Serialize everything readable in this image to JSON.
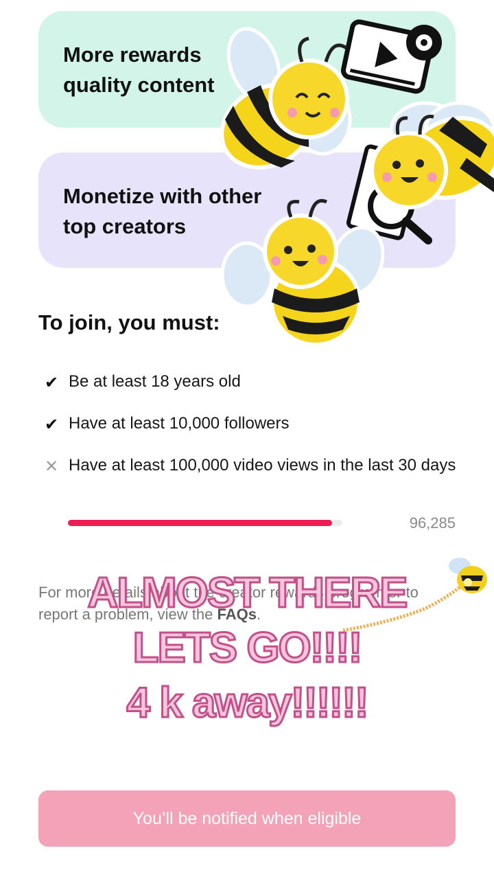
{
  "cards": [
    {
      "text": "More rewards\nquality content"
    },
    {
      "text": "Monetize with other\ntop creators"
    }
  ],
  "requirements": {
    "title": "To join, you must:",
    "items": [
      {
        "text": "Be at least 18 years old",
        "met": true,
        "icon": "check-icon"
      },
      {
        "text": "Have at least 10,000 followers",
        "met": true,
        "icon": "check-icon"
      },
      {
        "text": "Have at least 100,000 video views in the last 30 days",
        "met": false,
        "icon": "x-icon"
      }
    ],
    "progress": {
      "value_label": "96,285",
      "fraction": 0.963
    }
  },
  "faq": {
    "prefix": "For more details about the creator rewards program or to report a problem, view the ",
    "link": "FAQs",
    "suffix": "."
  },
  "overlay": {
    "line1": "ALMOST THERE",
    "line2": "LETS GO!!!!",
    "line3": "4 k away!!!!!!"
  },
  "cta": {
    "label": "You’ll be notified when eligible"
  },
  "colors": {
    "accent": "#ee1d52",
    "cta": "#f3a2b8",
    "card_green": "#d3f4e9",
    "card_purple": "#e7e3fb"
  },
  "stickers": [
    "bee-sticker",
    "video-play-sticker",
    "magnifier-sticker",
    "flying-bee-sticker"
  ]
}
